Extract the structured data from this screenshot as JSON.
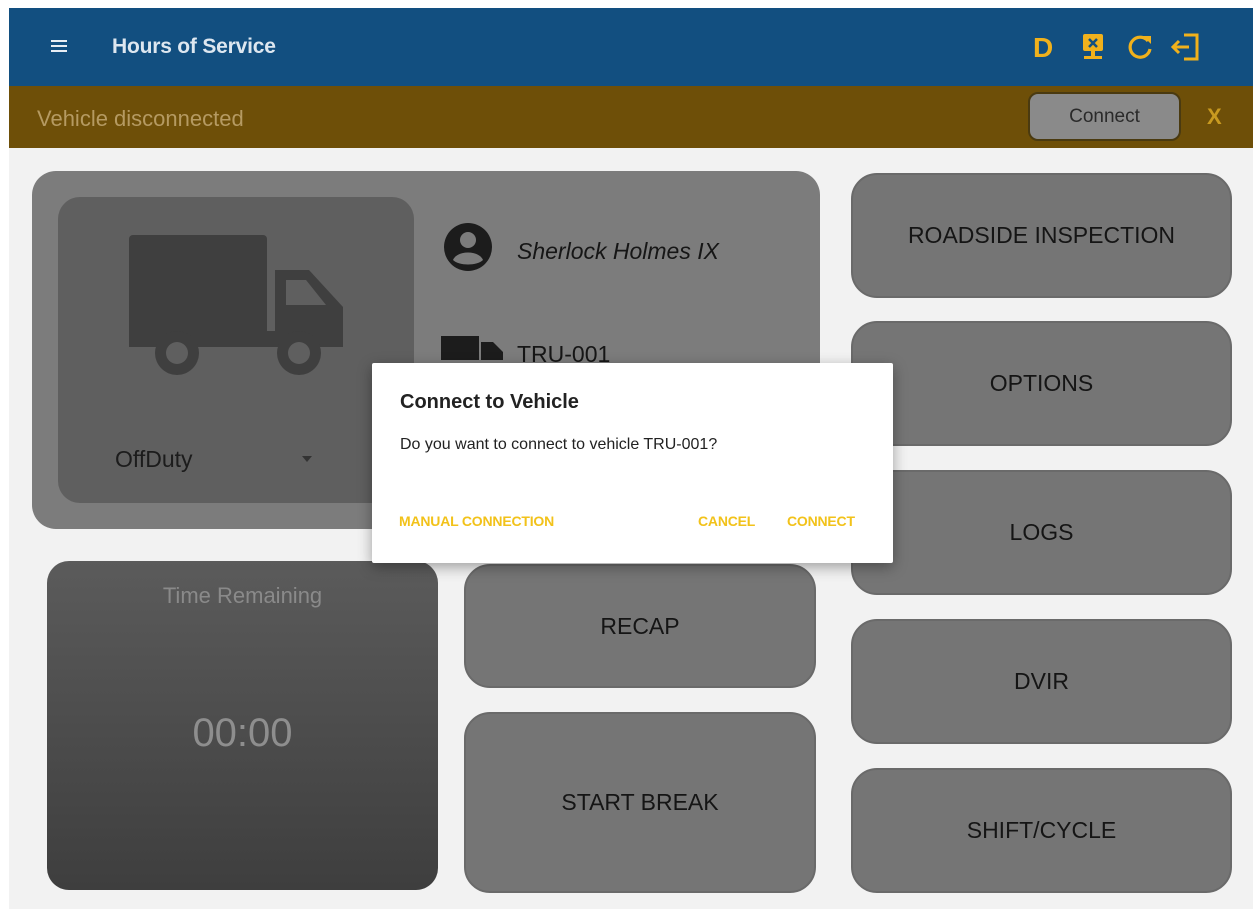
{
  "app_bar": {
    "title": "Hours of Service",
    "duty_status_letter": "D",
    "icons": [
      "menu-icon",
      "vehicle-disconnected-icon",
      "refresh-icon",
      "logout-icon"
    ]
  },
  "banner": {
    "text": "Vehicle disconnected",
    "connect_label": "Connect",
    "close_label": "X"
  },
  "driver": {
    "name": "Sherlock Holmes IX",
    "vehicle": "TRU-001",
    "status": "OffDuty"
  },
  "time_remaining": {
    "label": "Time Remaining",
    "value": "00:00"
  },
  "buttons": {
    "recap": "RECAP",
    "start_break": "START BREAK",
    "roadside_inspection": "ROADSIDE INSPECTION",
    "options": "OPTIONS",
    "logs": "LOGS",
    "dvir": "DVIR",
    "shift_cycle": "SHIFT/CYCLE"
  },
  "dialog": {
    "title": "Connect to Vehicle",
    "message": "Do you want to connect to vehicle TRU-001?",
    "manual_connection": "MANUAL CONNECTION",
    "cancel": "CANCEL",
    "connect": "CONNECT"
  },
  "colors": {
    "app_bar": "#124f80",
    "duty_letter": "#f0b11c",
    "banner": "#6e4f08",
    "dialog_action": "#f2c21a"
  }
}
